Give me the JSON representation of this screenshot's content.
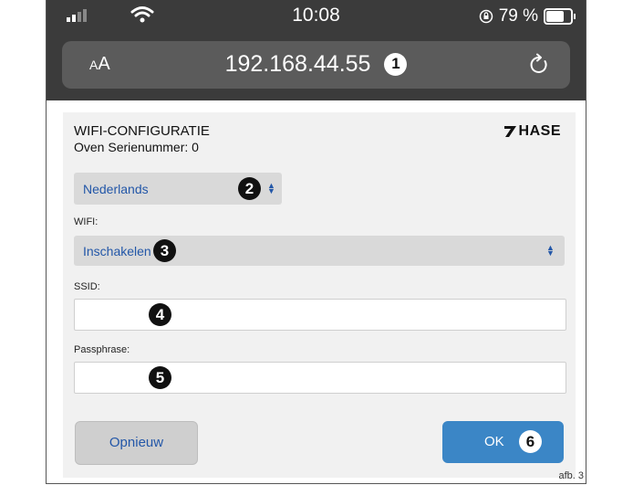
{
  "status_bar": {
    "time": "10:08",
    "battery": "79 %",
    "battery_level": 0.79
  },
  "browser": {
    "text_size_label_small": "A",
    "text_size_label_large": "A",
    "url": "192.168.44.55"
  },
  "form": {
    "title": "WIFI-CONFIGURATIE",
    "serial": "Oven Serienummer: 0",
    "logo_text": "HASE",
    "language_select": {
      "value": "Nederlands"
    },
    "wifi_label": "WIFI:",
    "wifi_select": {
      "value": "Inschakelen"
    },
    "ssid_label": "SSID:",
    "ssid_value": "",
    "passphrase_label": "Passphrase:",
    "passphrase_value": "",
    "reset_button": "Opnieuw",
    "ok_button": "OK"
  },
  "callouts": [
    "1",
    "2",
    "3",
    "4",
    "5",
    "6"
  ],
  "figure_label": "afb. 3",
  "colors": {
    "accent": "#3b86c6",
    "link": "#2357a8",
    "browser_chrome": "#3b3b3b"
  }
}
